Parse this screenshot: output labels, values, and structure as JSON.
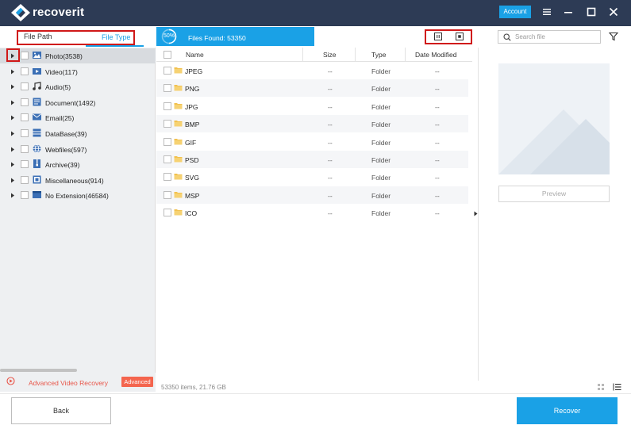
{
  "app": {
    "brand": "recoverit",
    "account_label": "Account"
  },
  "tabs": {
    "file_path": "File Path",
    "file_type": "File Type"
  },
  "scan": {
    "progress_label": "50%",
    "progress_fraction": 0.5,
    "files_found_label": "Files Found:  53350"
  },
  "search": {
    "placeholder": "Search file"
  },
  "sidebar": {
    "items": [
      {
        "label": "Photo(3538)",
        "icon": "photo-icon"
      },
      {
        "label": "Video(117)",
        "icon": "video-icon"
      },
      {
        "label": "Audio(5)",
        "icon": "audio-icon"
      },
      {
        "label": "Document(1492)",
        "icon": "document-icon"
      },
      {
        "label": "Email(25)",
        "icon": "email-icon"
      },
      {
        "label": "DataBase(39)",
        "icon": "database-icon"
      },
      {
        "label": "Webfiles(597)",
        "icon": "globe-icon"
      },
      {
        "label": "Archive(39)",
        "icon": "archive-icon"
      },
      {
        "label": "Miscellaneous(914)",
        "icon": "miscellaneous-icon"
      },
      {
        "label": "No Extension(46584)",
        "icon": "no-extension-icon"
      }
    ],
    "advanced_video_label": "Advanced Video Recovery",
    "advanced_badge": "Advanced"
  },
  "file_list": {
    "columns": [
      "Name",
      "Size",
      "Type",
      "Date Modified"
    ],
    "rows": [
      {
        "name": "JPEG",
        "size": "--",
        "type": "Folder",
        "date": "--"
      },
      {
        "name": "PNG",
        "size": "--",
        "type": "Folder",
        "date": "--"
      },
      {
        "name": "JPG",
        "size": "--",
        "type": "Folder",
        "date": "--"
      },
      {
        "name": "BMP",
        "size": "--",
        "type": "Folder",
        "date": "--"
      },
      {
        "name": "GIF",
        "size": "--",
        "type": "Folder",
        "date": "--"
      },
      {
        "name": "PSD",
        "size": "--",
        "type": "Folder",
        "date": "--"
      },
      {
        "name": "SVG",
        "size": "--",
        "type": "Folder",
        "date": "--"
      },
      {
        "name": "MSP",
        "size": "--",
        "type": "Folder",
        "date": "--"
      },
      {
        "name": "ICO",
        "size": "--",
        "type": "Folder",
        "date": "--"
      }
    ]
  },
  "preview": {
    "button_label": "Preview"
  },
  "status": {
    "summary": "53350 items, 21.76  GB"
  },
  "footer": {
    "back_label": "Back",
    "recover_label": "Recover"
  },
  "colors": {
    "titlebar": "#2d3b55",
    "accent": "#1aa1e6",
    "highlight_box": "#d01818",
    "advanced": "#f4654e"
  }
}
